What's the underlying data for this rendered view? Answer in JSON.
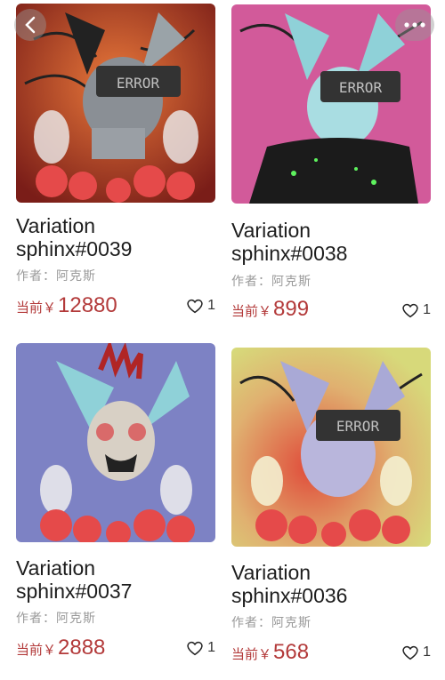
{
  "nav": {
    "back_icon": "chevron-left-icon",
    "more_icon": "more-dots-icon"
  },
  "items": [
    {
      "title": "Variation\nsphinx#0039",
      "author": "作者：阿克斯",
      "price_label": "当前￥",
      "price": "12880",
      "likes": "1",
      "sign_text": "ERROR",
      "bg": "#b5442a"
    },
    {
      "title": "Variation\nsphinx#0038",
      "author": "作者：阿克斯",
      "price_label": "当前￥",
      "price": "899",
      "likes": "1",
      "sign_text": "ERROR",
      "bg": "#d25a9a"
    },
    {
      "title": "Variation\nsphinx#0037",
      "author": "作者：阿克斯",
      "price_label": "当前￥",
      "price": "2888",
      "likes": "1",
      "bg": "#7d82c4"
    },
    {
      "title": "Variation\nsphinx#0036",
      "author": "作者：阿克斯",
      "price_label": "当前￥",
      "price": "568",
      "likes": "1",
      "sign_text": "ERROR",
      "bg": "#d7d97a"
    }
  ],
  "colors": {
    "price": "#b33a3a",
    "title": "#1d1d1d",
    "author": "#9a9a9a"
  }
}
